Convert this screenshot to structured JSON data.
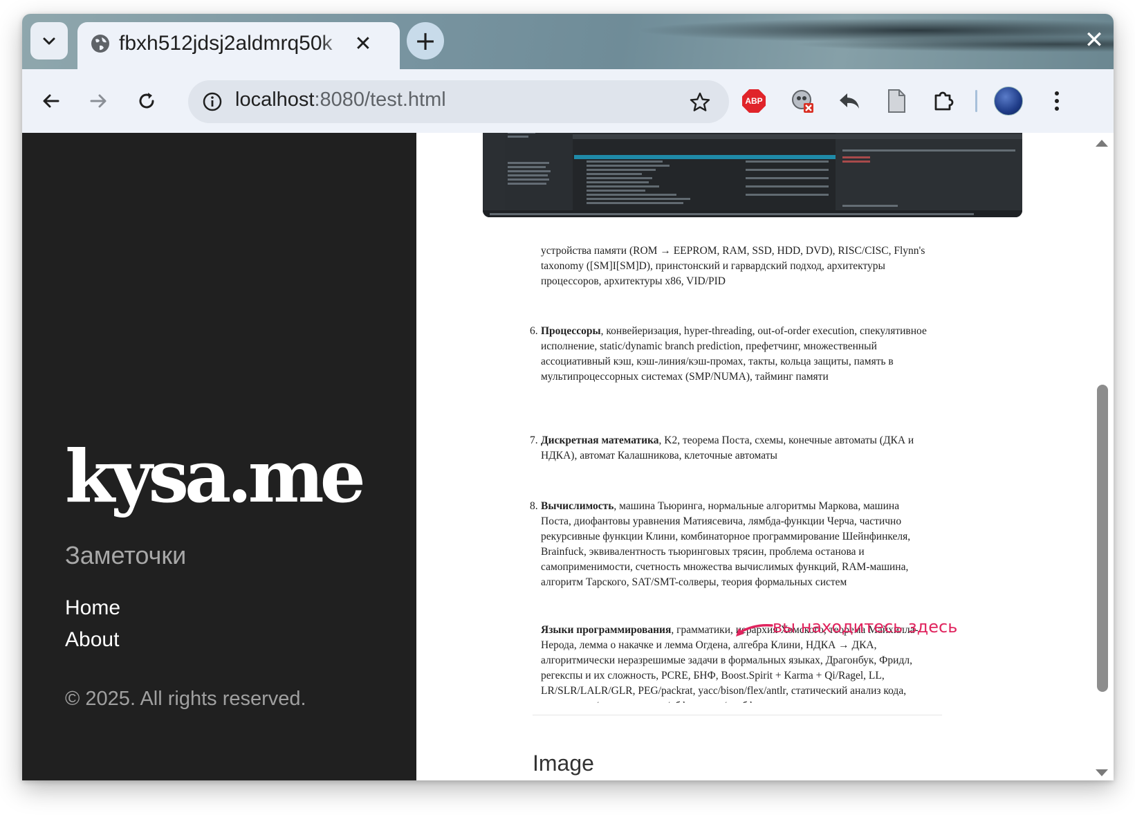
{
  "browser": {
    "tab_title": "fbxh512jdsj2aldmrq50k",
    "address_host": "localhost",
    "address_path": ":8080/test.html",
    "extensions": [
      "abp-icon",
      "privacy-blocked-icon",
      "reply-arrow-icon",
      "document-icon",
      "puzzle-extensions-icon"
    ],
    "abp_label": "ABP"
  },
  "sidebar": {
    "brand": "kysa.me",
    "tagline": "Заметочки",
    "nav": [
      {
        "label": "Home"
      },
      {
        "label": "About"
      }
    ],
    "copyright": "© 2025. All rights reserved."
  },
  "content": {
    "continued_text": "устройства памяти (ROM → EEPROM, RAM, SSD, HDD, DVD), RISC/CISC, Flynn's taxonomy ([SM]I[SM]D), принстонский и гарвардский подход, архитектуры процессоров, архитектуры x86, VID/PID",
    "items": [
      {
        "num": "6.",
        "title": "Процессоры",
        "text": ", конвейеризация, hyper-threading, out-of-order execution, спекулятивное исполнение, static/dynamic branch prediction, префетчинг, множественный ассоциативный кэш, кэш-линия/кэш-промах, такты, кольца защиты, память в мультипроцессорных системах (SMP/NUMA), тайминг памяти"
      },
      {
        "num": "7.",
        "title": "Дискретная математика",
        "text": ", K2, теорема Поста, схемы, конечные автоматы (ДКА и НДКА), автомат Калашникова, клеточные автоматы"
      },
      {
        "num": "8.",
        "title": "Вычислимость",
        "text": ", машина Тьюринга, нормальные алгоритмы Маркова, машина Поста, диофантовы уравнения Матиясевича, лямбда-функции Черча, частично рекурсивные функции Клини, комбинаторное программирование Шейнфинкеля, Brainfuck, эквивалентность тьюринговых трясин, проблема останова и самоприменимости, счетность множества вычислимых функций, RAM-машина, алгоритм Тарского, SAT/SMT-солверы, теория формальных систем"
      },
      {
        "num": "9.",
        "title": "Языки программирования",
        "text": ", грамматики, иерархия Хомского, теорема Майхилла-Нерода, лемма о накачке и лемма Огдена, алгебра Клини, НДКА → ДКА, алгоритмически неразрешимые задачи в формальных языках, Драгонбук, Фридл, регекспы и их сложность, PCRE, БНФ, Boost.Spirit + Karma + Qi/Ragel, LL, LR/SLR/LALR/GLR, PEG/packrat, yacc/bison/flex/antlr, статический анализ кода, компиляция/интерпретация/обфускация/деобфускация"
      }
    ],
    "annotation": "вы находитесь здесь",
    "next_section": "Image"
  },
  "colors": {
    "sidebar_bg": "#202020",
    "annotation": "#e0245e",
    "abp_red": "#e0242a"
  }
}
